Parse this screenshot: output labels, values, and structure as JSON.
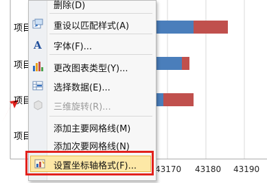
{
  "chart": {
    "row_labels": [
      "项目",
      "项目",
      "项目",
      "项目"
    ],
    "x_ticks": [
      "43170",
      "43180",
      "43190"
    ],
    "colors": {
      "series1": "#4a7ebb",
      "series2": "#c0504d",
      "axis": "#a6a6a6",
      "arrow": "#e2211c"
    }
  },
  "menu": {
    "items": [
      {
        "label": "删除(D)",
        "icon": "delete-icon",
        "disabled": false
      },
      {
        "label": "重设以匹配样式(A)",
        "icon": "reset-style-icon",
        "disabled": false
      },
      {
        "label": "字体(F)...",
        "icon": "font-icon",
        "disabled": false
      },
      {
        "label": "更改图表类型(Y)...",
        "icon": "chart-type-icon",
        "disabled": false
      },
      {
        "label": "选择数据(E)...",
        "icon": "select-data-icon",
        "disabled": false
      },
      {
        "label": "三维旋转(R)...",
        "icon": "3d-rotate-icon",
        "disabled": true
      },
      {
        "label": "添加主要网格线(M)",
        "icon": "",
        "disabled": false
      },
      {
        "label": "添加次要网格线(N)",
        "icon": "",
        "disabled": false
      },
      {
        "label": "设置坐标轴格式(F)...",
        "icon": "format-axis-icon",
        "disabled": false
      }
    ]
  }
}
